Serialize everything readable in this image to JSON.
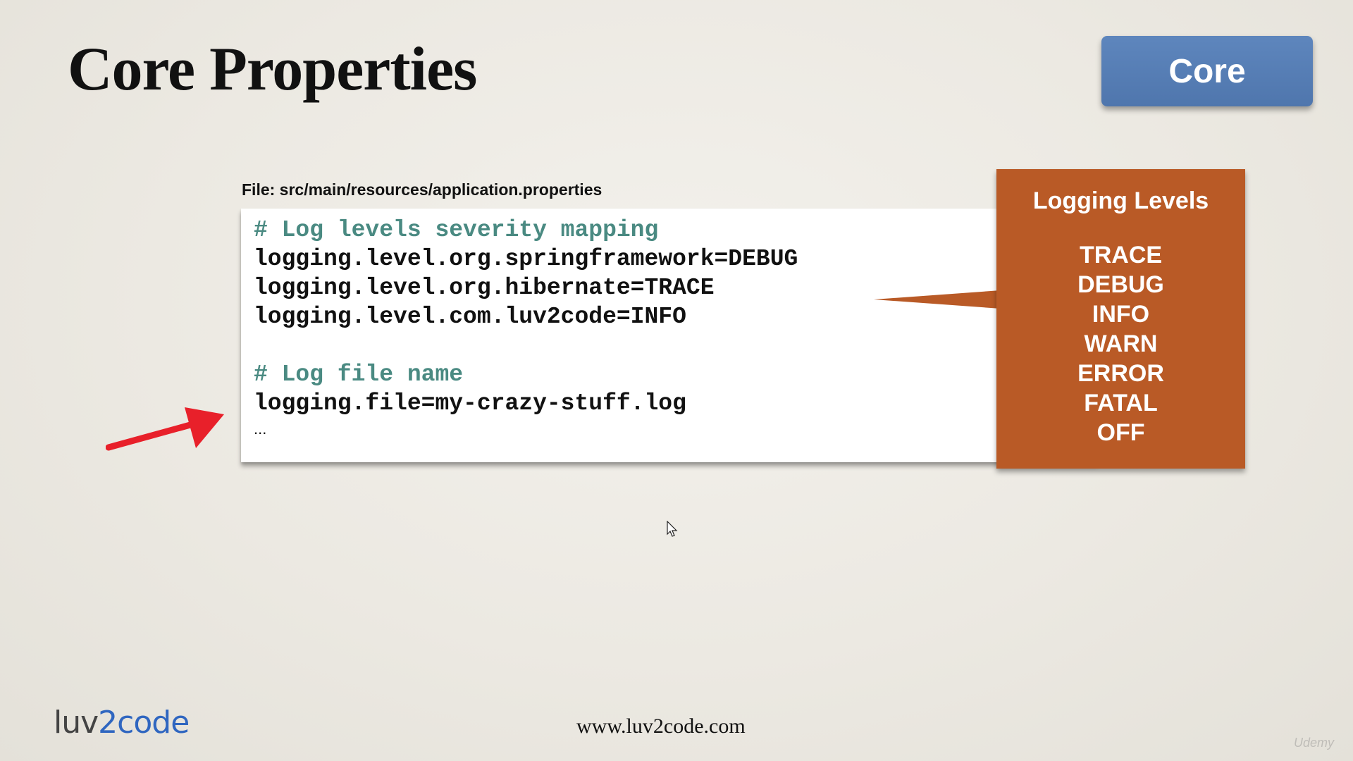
{
  "slide": {
    "title": "Core Properties",
    "badge_label": "Core",
    "file_label": "File: src/main/resources/application.properties",
    "code": {
      "lines": [
        {
          "text": "# Log levels severity mapping",
          "kind": "comment"
        },
        {
          "text": "logging.level.org.springframework=DEBUG",
          "kind": "code"
        },
        {
          "text": "logging.level.org.hibernate=TRACE",
          "kind": "code"
        },
        {
          "text": "logging.level.com.luv2code=INFO",
          "kind": "code"
        },
        {
          "text": "",
          "kind": "blank"
        },
        {
          "text": "# Log file name",
          "kind": "comment"
        },
        {
          "text": "logging.file=my-crazy-stuff.log",
          "kind": "code"
        }
      ],
      "ellipsis": "..."
    },
    "levels_box": {
      "title": "Logging Levels",
      "levels": [
        "TRACE",
        "DEBUG",
        "INFO",
        "WARN",
        "ERROR",
        "FATAL",
        "OFF"
      ]
    },
    "footer_url": "www.luv2code.com",
    "logo": {
      "part1": "luv",
      "part2": "2",
      "part3": "code"
    },
    "watermark": "Udemy"
  },
  "colors": {
    "badge": "#4f76ad",
    "levels_box": "#b95a26",
    "comment": "#4a8a82",
    "arrow": "#e8202a"
  },
  "icons": {
    "arrow": "red-arrow-icon",
    "cursor": "mouse-cursor-icon"
  }
}
